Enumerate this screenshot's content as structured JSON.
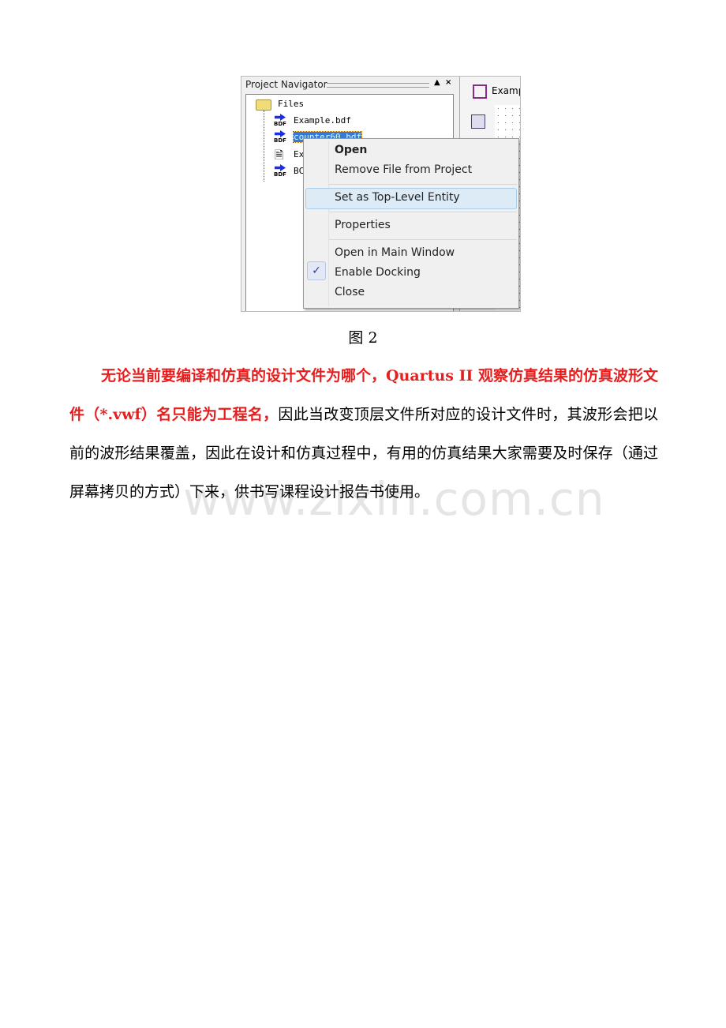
{
  "screenshot": {
    "panel_title": "Project Navigator",
    "pin_icon": "▲",
    "close_icon": "×",
    "tree": {
      "root": "Files",
      "items": [
        {
          "label": "Example.bdf",
          "icon": "BDF"
        },
        {
          "label": "counter60.bdf",
          "icon": "BDF",
          "selected": true
        },
        {
          "label": "Ex",
          "icon": "document"
        },
        {
          "label": "BC",
          "icon": "BDF"
        }
      ]
    },
    "right_tab": "Examp",
    "context_menu": [
      "Open",
      "Remove File from Project",
      "Set as Top-Level Entity",
      "Properties",
      "Open in Main Window",
      "Enable Docking",
      "Close"
    ],
    "checked_item": "Enable Docking",
    "hover_item": "Set as Top-Level Entity"
  },
  "caption": "图 2",
  "paragraph": {
    "red_bold": "无论当前要编译和仿真的设计文件为哪个，Quartus II 观察仿真结果的仿真波形文件（*.vwf）名只能为工程名，",
    "normal": "因此当改变顶层文件所对应的设计文件时，其波形会把以前的波形结果覆盖，因此在设计和仿真过程中，有用的仿真结果大家需要及时保存（通过屏幕拷贝的方式）下来，供书写课程设计报告书使用。"
  },
  "watermark": "www.zixin.com.cn",
  "colors": {
    "emphasis": "#e61e1e",
    "menu_highlight": "#dcebf6"
  }
}
